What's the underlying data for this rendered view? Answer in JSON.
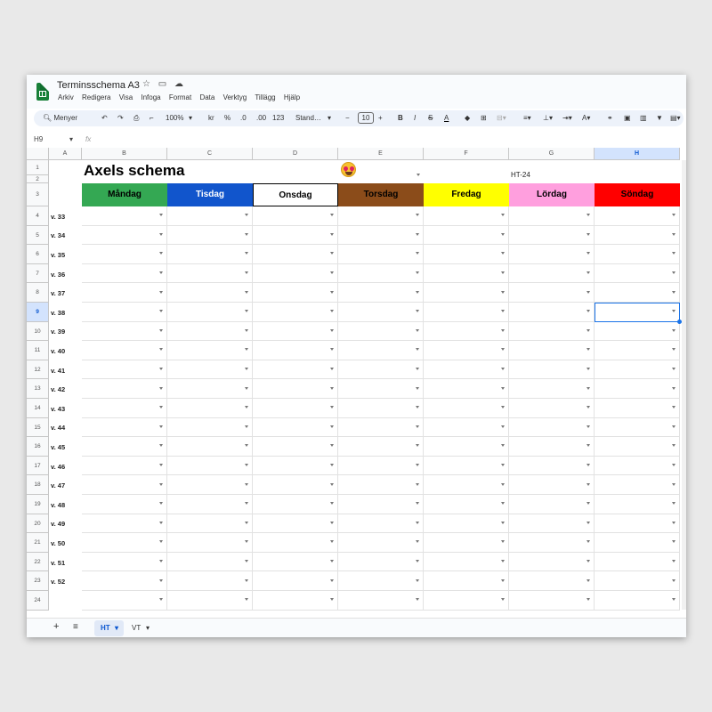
{
  "doc_title": "Terminsschema A3",
  "menu": [
    "Arkiv",
    "Redigera",
    "Visa",
    "Infoga",
    "Format",
    "Data",
    "Verktyg",
    "Tillägg",
    "Hjälp"
  ],
  "toolbar": {
    "search": "Menyer",
    "zoom": "100%",
    "currency": "kr",
    "percent": "%",
    "dec_minus": ".0",
    "dec_plus": ".00",
    "number_format": "123",
    "font": "Stand…",
    "font_size": "10"
  },
  "formula_bar": {
    "cell_ref": "H9",
    "fx": "fx"
  },
  "columns": [
    "A",
    "B",
    "C",
    "D",
    "E",
    "F",
    "G",
    "H"
  ],
  "selected_column": "H",
  "selected_row": "9",
  "sheet_title": "Axels schema",
  "term_label": "HT-24",
  "days": [
    {
      "label": "Måndag",
      "bg": "#34a853",
      "fg": "#000000"
    },
    {
      "label": "Tisdag",
      "bg": "#1155cc",
      "fg": "#ffffff"
    },
    {
      "label": "Onsdag",
      "bg": "#ffffff",
      "fg": "#000000"
    },
    {
      "label": "Torsdag",
      "bg": "#8b4c1a",
      "fg": "#000000"
    },
    {
      "label": "Fredag",
      "bg": "#ffff00",
      "fg": "#000000"
    },
    {
      "label": "Lördag",
      "bg": "#ff9fde",
      "fg": "#000000"
    },
    {
      "label": "Söndag",
      "bg": "#ff0000",
      "fg": "#000000"
    }
  ],
  "row_numbers": [
    "1",
    "2",
    "3",
    "4",
    "5",
    "6",
    "7",
    "8",
    "9",
    "10",
    "11",
    "12",
    "13",
    "14",
    "15",
    "16",
    "17",
    "18",
    "19",
    "20",
    "21",
    "22",
    "23",
    "24"
  ],
  "weeks": [
    "v. 33",
    "v. 34",
    "v. 35",
    "v. 36",
    "v. 37",
    "v. 38",
    "v. 39",
    "v. 40",
    "v. 41",
    "v. 42",
    "v. 43",
    "v. 44",
    "v. 45",
    "v. 46",
    "v. 47",
    "v. 48",
    "v. 49",
    "v. 50",
    "v. 51",
    "v. 52"
  ],
  "sheet_tabs": [
    "HT",
    "VT"
  ],
  "active_sheet": "HT"
}
